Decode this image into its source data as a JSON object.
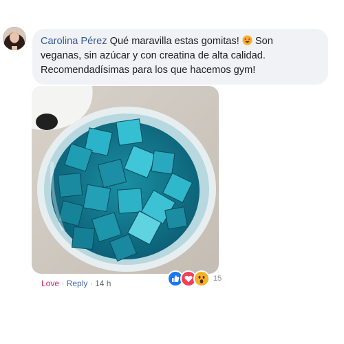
{
  "comment": {
    "author": "Carolina Pérez",
    "text_line1": "Qué maravilla estas gomitas!",
    "text_line1_tail": "Son",
    "text_line2": "veganas, sin azúcar y con creatina de alta calidad.",
    "text_line3": "Recomendadísimas para los que hacemos gym!",
    "emoji": "star-struck-emoji"
  },
  "attachment": {
    "subject": "blue cube gummies in a jar"
  },
  "actions": {
    "love_label": "Love",
    "separator": "·",
    "reply_label": "Reply",
    "time": "14 h"
  },
  "reactions": {
    "icons": [
      "like-icon",
      "love-icon",
      "wow-icon"
    ],
    "count": "15"
  },
  "colors": {
    "author_link": "#385898",
    "love_text": "#e0245e",
    "reply_text": "#4267b2",
    "bubble_bg": "#f0f2f5",
    "like_blue": "#1877f2",
    "love_red": "#f33e58",
    "wow_yellow": "#f7b125"
  }
}
